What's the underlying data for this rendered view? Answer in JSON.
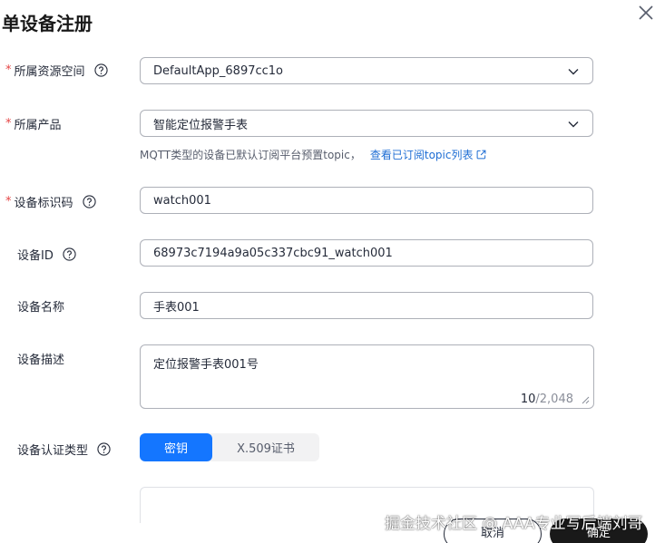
{
  "dialog": {
    "title": "单设备注册"
  },
  "form": {
    "resource_space": {
      "label": "所属资源空间",
      "value": "DefaultApp_6897cc1o"
    },
    "product": {
      "label": "所属产品",
      "value": "智能定位报警手表",
      "hint": "MQTT类型的设备已默认订阅平台预置topic，",
      "hint_link": "查看已订阅topic列表"
    },
    "node_id": {
      "label": "设备标识码",
      "value": "watch001"
    },
    "device_id": {
      "label": "设备ID",
      "value": "68973c7194a9a05c337cbc91_watch001"
    },
    "device_name": {
      "label": "设备名称",
      "value": "手表001"
    },
    "description": {
      "label": "设备描述",
      "value": "定位报警手表001号",
      "count": "10",
      "max": "/2,048"
    },
    "auth_type": {
      "label": "设备认证类型",
      "options": [
        "密钥",
        "X.509证书"
      ],
      "selected": "密钥"
    }
  },
  "footer": {
    "cancel_label": "取消",
    "confirm_label": "确定"
  },
  "watermark": "掘金技术社区 @ AAA专业写后端刘哥",
  "colors": {
    "primary": "#1476ff",
    "required": "#e54545",
    "link": "#1f6ed4",
    "confirm_bg": "#191919"
  }
}
